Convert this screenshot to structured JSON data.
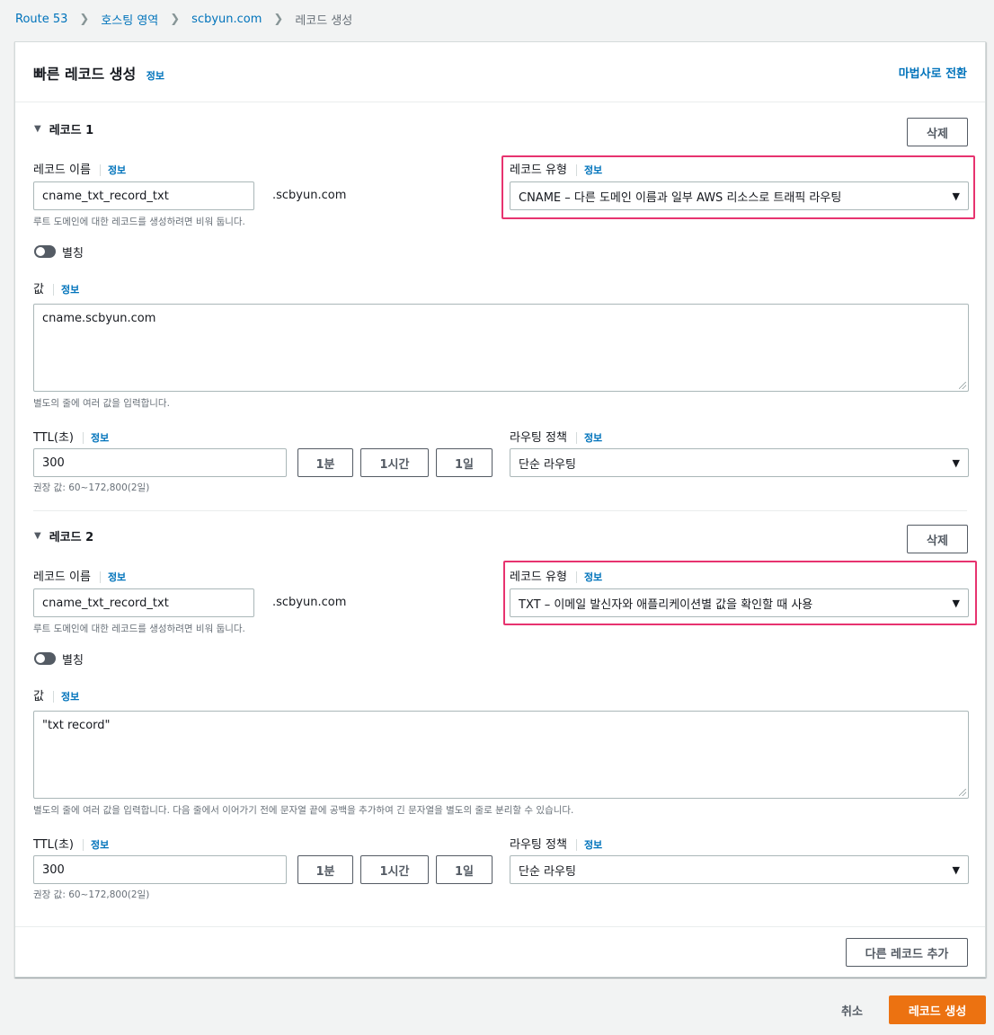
{
  "breadcrumb": {
    "items": [
      "Route 53",
      "호스팅 영역",
      "scbyun.com",
      "레코드 생성"
    ]
  },
  "panel": {
    "title": "빠른 레코드 생성",
    "info": "정보",
    "wizard_link": "마법사로 전환"
  },
  "records": [
    {
      "header": "레코드 1",
      "delete": "삭제",
      "name_label": "레코드 이름",
      "info": "정보",
      "name_value": "cname_txt_record_txt",
      "domain_suffix": ".scbyun.com",
      "name_hint": "루트 도메인에 대한 레코드를 생성하려면 비워 둡니다.",
      "type_label": "레코드 유형",
      "type_value": "CNAME – 다른 도메인 이름과 일부 AWS 리소스로 트래픽 라우팅",
      "alias_label": "별칭",
      "value_label": "값",
      "value_text": "cname.scbyun.com",
      "value_hint": "별도의 줄에 여러 값을 입력합니다.",
      "ttl_label": "TTL(초)",
      "ttl_value": "300",
      "ttl_buttons": [
        "1분",
        "1시간",
        "1일"
      ],
      "ttl_hint": "권장 값: 60~172,800(2일)",
      "routing_label": "라우팅 정책",
      "routing_value": "단순 라우팅"
    },
    {
      "header": "레코드 2",
      "delete": "삭제",
      "name_label": "레코드 이름",
      "info": "정보",
      "name_value": "cname_txt_record_txt",
      "domain_suffix": ".scbyun.com",
      "name_hint": "루트 도메인에 대한 레코드를 생성하려면 비워 둡니다.",
      "type_label": "레코드 유형",
      "type_value": "TXT – 이메일 발신자와 애플리케이션별 값을 확인할 때 사용",
      "alias_label": "별칭",
      "value_label": "값",
      "value_text": "\"txt record\"",
      "value_hint": "별도의 줄에 여러 값을 입력합니다. 다음 줄에서 이어가기 전에 문자열 끝에 공백을 추가하여 긴 문자열을 별도의 줄로 분리할 수 있습니다.",
      "ttl_label": "TTL(초)",
      "ttl_value": "300",
      "ttl_buttons": [
        "1분",
        "1시간",
        "1일"
      ],
      "ttl_hint": "권장 값: 60~172,800(2일)",
      "routing_label": "라우팅 정책",
      "routing_value": "단순 라우팅"
    }
  ],
  "footer": {
    "add_record": "다른 레코드 추가",
    "cancel": "취소",
    "create": "레코드 생성"
  },
  "colors": {
    "accent": "#0073bb",
    "primary": "#ec7211",
    "highlight": "#e7336f"
  }
}
